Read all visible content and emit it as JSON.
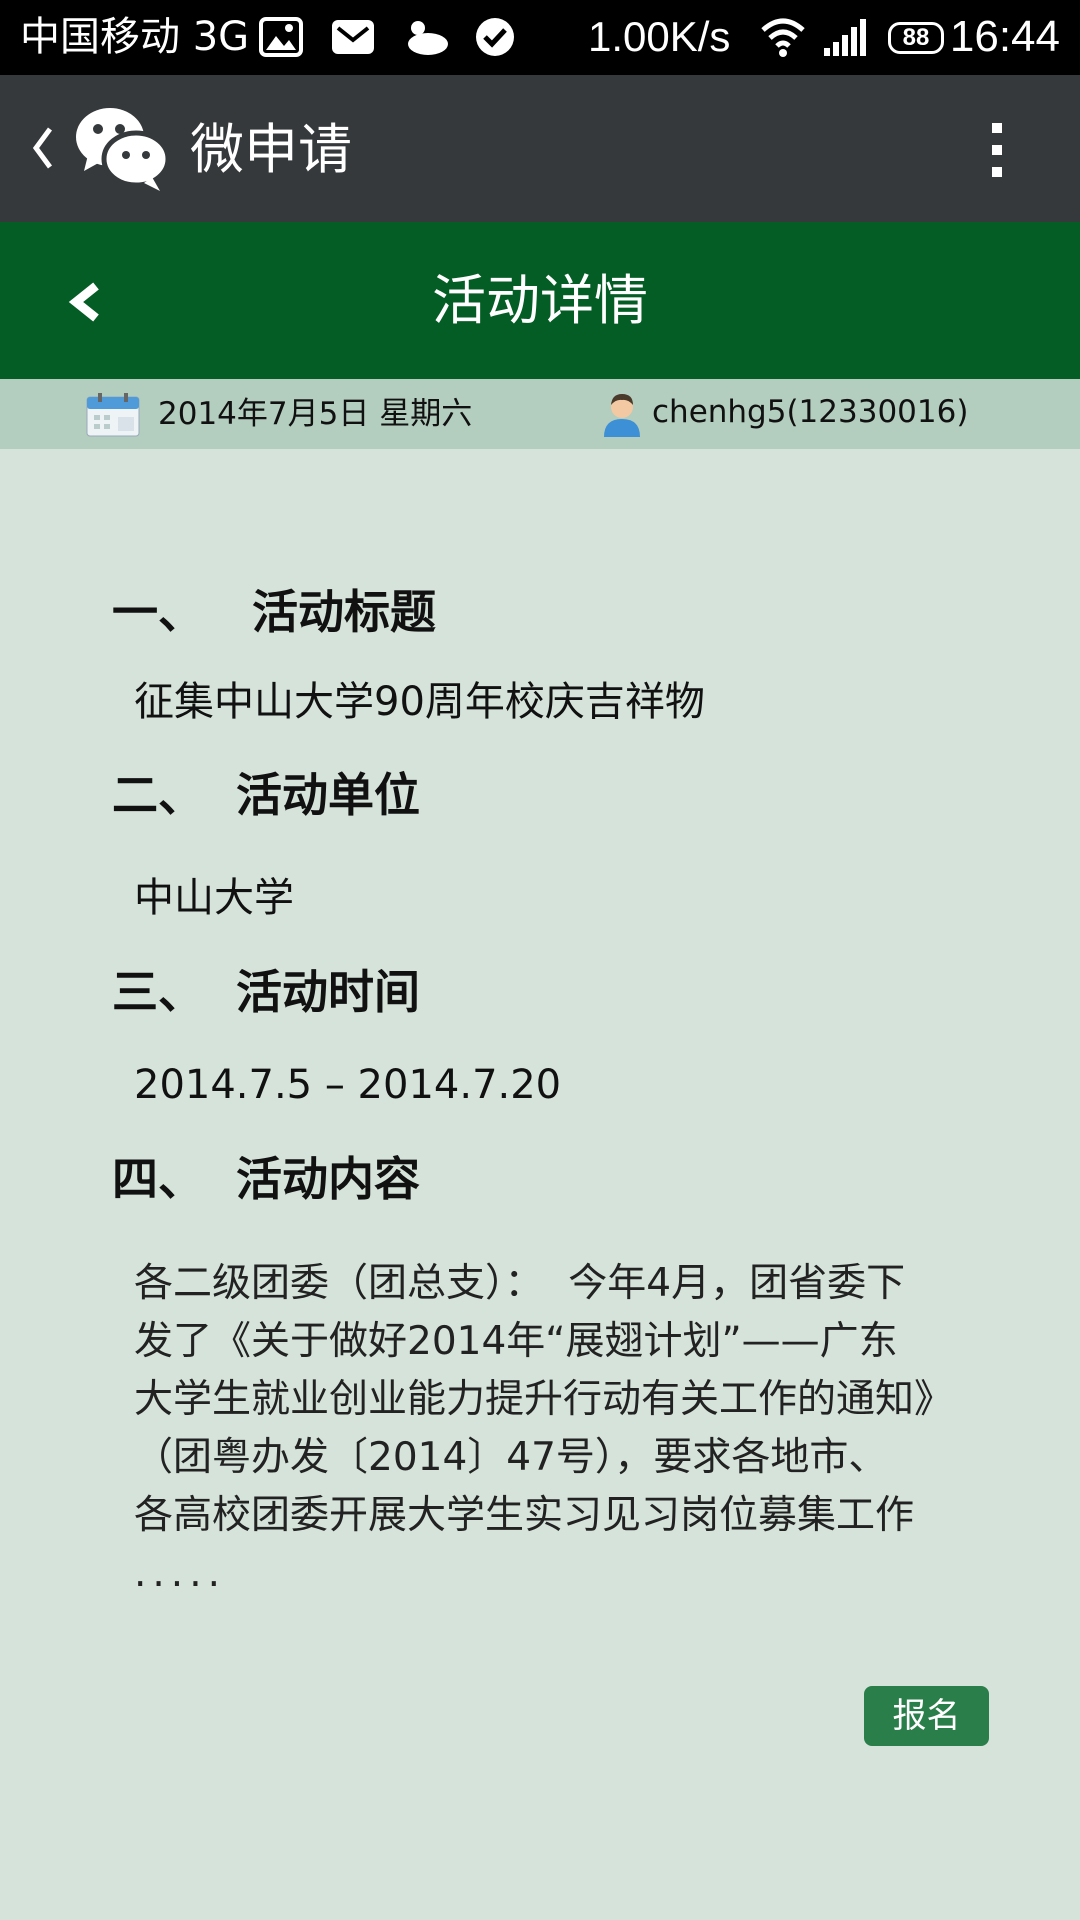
{
  "status_bar": {
    "carrier": "中国移动 3G",
    "speed": "1.00K/s",
    "battery": "88",
    "time": "16:44"
  },
  "wechat_bar": {
    "title": "微申请"
  },
  "header": {
    "title": "活动详情"
  },
  "info": {
    "date": "2014年7月5日  星期六",
    "user": "chenhg5(12330016)"
  },
  "sections": [
    {
      "heading": "一、   活动标题",
      "text": "征集中山大学90周年校庆吉祥物"
    },
    {
      "heading": "二、  活动单位",
      "text": "中山大学"
    },
    {
      "heading": "三、  活动时间",
      "text": "2014.7.5 – 2014.7.20"
    },
    {
      "heading": "四、  活动内容"
    }
  ],
  "content_lines": [
    "各二级团委（团总支）：  今年4月，团省委下",
    "发了《关于做好2014年“展翅计划”——广东",
    "大学生就业创业能力提升行动有关工作的通知》",
    "（团粤办发〔2014〕47号），要求各地市、",
    "各高校团委开展大学生实习见习岗位募集工作",
    "....."
  ],
  "signup_label": "报名",
  "colors": {
    "status_bg": "#000000",
    "wechat_bar_bg": "#35393c",
    "header_bg": "#035d24",
    "info_bg": "#b3cdbe",
    "page_bg": "#d5e3da",
    "button_bg": "#2a7e49"
  }
}
